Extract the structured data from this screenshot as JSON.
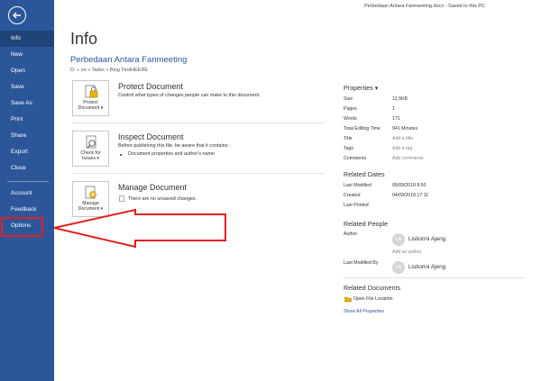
{
  "title_bar": "Perbedaan Antara Fanmeeting.docx  -  Saved to this PC",
  "sidebar": {
    "back_icon": "back-arrow-icon",
    "items": [
      {
        "label": "Info",
        "active": true
      },
      {
        "label": "New"
      },
      {
        "label": "Open"
      },
      {
        "label": "Save"
      },
      {
        "label": "Save As"
      },
      {
        "label": "Print"
      },
      {
        "label": "Share"
      },
      {
        "label": "Export"
      },
      {
        "label": "Close"
      },
      {
        "label": "Account"
      },
      {
        "label": "Feedback"
      },
      {
        "label": "Options"
      }
    ]
  },
  "main": {
    "title": "Info",
    "doc_title": "Perbedaan Antara Fanmeeting",
    "breadcrumb": "D: » ori » Tasks » Blog FindHEERE",
    "protect": {
      "button_label_1": "Protect",
      "button_label_2": "Document ▾",
      "heading": "Protect Document",
      "text": "Control what types of changes people can make to this document."
    },
    "inspect": {
      "button_label_1": "Check for",
      "button_label_2": "Issues ▾",
      "heading": "Inspect Document",
      "text": "Before publishing this file, be aware that it contains:",
      "bullet": "Document properties and author's name"
    },
    "manage": {
      "button_label_1": "Manage",
      "button_label_2": "Document ▾",
      "heading": "Manage Document",
      "text": "There are no unsaved changes."
    }
  },
  "properties": {
    "heading": "Properties ▾",
    "rows": [
      {
        "label": "Size",
        "value": "12,5KB"
      },
      {
        "label": "Pages",
        "value": "1"
      },
      {
        "label": "Words",
        "value": "171"
      },
      {
        "label": "Total Editing Time",
        "value": "941 Minutes"
      },
      {
        "label": "Title",
        "value": "Add a title"
      },
      {
        "label": "Tags",
        "value": "Add a tag"
      },
      {
        "label": "Comments",
        "value": "Add comments"
      }
    ],
    "dates_heading": "Related Dates",
    "dates": [
      {
        "label": "Last Modified",
        "value": "05/09/2018 8:50"
      },
      {
        "label": "Created",
        "value": "04/09/2018 17:11"
      },
      {
        "label": "Last Printed",
        "value": ""
      }
    ],
    "people_heading": "Related People",
    "author_label": "Author",
    "author_initials": "LA",
    "author_name": "Listiorini Ajeng",
    "add_author": "Add an author",
    "modified_by_label": "Last Modified By",
    "modified_initials": "LA",
    "modified_name": "Listiorini Ajeng",
    "docs_heading": "Related Documents",
    "open_location": "Open File Location",
    "show_all": "Show All Properties"
  },
  "colors": {
    "sidebar": "#2b579a",
    "annotation": "#e02020"
  }
}
